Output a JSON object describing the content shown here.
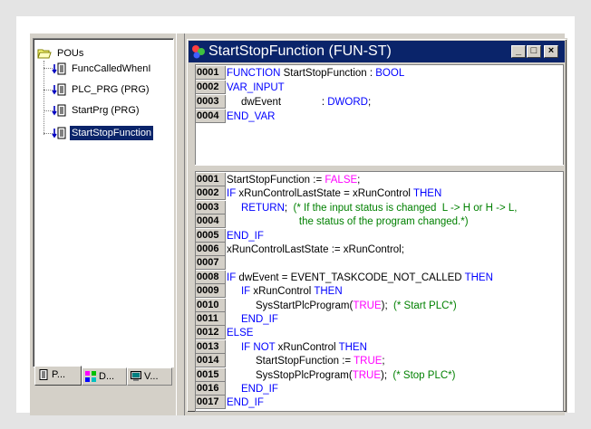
{
  "tree": {
    "root": "POUs",
    "items": [
      {
        "label": "FuncCalledWhenI",
        "selected": false
      },
      {
        "label": "PLC_PRG (PRG)",
        "selected": false
      },
      {
        "label": "StartPrg (PRG)",
        "selected": false
      },
      {
        "label": "StartStopFunction",
        "selected": true
      }
    ]
  },
  "tabs": [
    {
      "label": "P...",
      "icon": "pous-tab-icon"
    },
    {
      "label": "D...",
      "icon": "datatypes-tab-icon"
    },
    {
      "label": "V...",
      "icon": "visualizations-tab-icon"
    }
  ],
  "window": {
    "title": "StartStopFunction (FUN-ST)",
    "minimize": "_",
    "maximize": "□",
    "close": "×"
  },
  "declaration": [
    {
      "num": "0001",
      "parts": [
        {
          "t": "FUNCTION",
          "c": "kw"
        },
        {
          "t": " StartStopFunction : ",
          "c": ""
        },
        {
          "t": "BOOL",
          "c": "kw"
        }
      ]
    },
    {
      "num": "0002",
      "parts": [
        {
          "t": "VAR_INPUT",
          "c": "kw"
        }
      ]
    },
    {
      "num": "0003",
      "parts": [
        {
          "t": "     dwEvent              : ",
          "c": ""
        },
        {
          "t": "DWORD",
          "c": "kw"
        },
        {
          "t": ";",
          "c": ""
        }
      ]
    },
    {
      "num": "0004",
      "parts": [
        {
          "t": "END_VAR",
          "c": "kw"
        }
      ]
    }
  ],
  "body": [
    {
      "num": "0001",
      "parts": [
        {
          "t": "StartStopFunction := ",
          "c": ""
        },
        {
          "t": "FALSE",
          "c": "lit"
        },
        {
          "t": ";",
          "c": ""
        }
      ]
    },
    {
      "num": "0002",
      "parts": [
        {
          "t": "IF",
          "c": "kw"
        },
        {
          "t": " xRunControlLastState = xRunControl ",
          "c": ""
        },
        {
          "t": "THEN",
          "c": "kw"
        }
      ]
    },
    {
      "num": "0003",
      "parts": [
        {
          "t": "     ",
          "c": ""
        },
        {
          "t": "RETURN",
          "c": "kw"
        },
        {
          "t": ";  ",
          "c": ""
        },
        {
          "t": "(* If the input status is changed  L -> H or H -> L,",
          "c": "cm"
        }
      ]
    },
    {
      "num": "0004",
      "parts": [
        {
          "t": "                         the status of the program changed.*)",
          "c": "cm"
        }
      ]
    },
    {
      "num": "0005",
      "parts": [
        {
          "t": "END_IF",
          "c": "kw"
        }
      ]
    },
    {
      "num": "0006",
      "parts": [
        {
          "t": "xRunControlLastState := xRunControl;",
          "c": ""
        }
      ]
    },
    {
      "num": "0007",
      "parts": []
    },
    {
      "num": "0008",
      "parts": [
        {
          "t": "IF",
          "c": "kw"
        },
        {
          "t": " dwEvent = EVENT_TASKCODE_NOT_CALLED ",
          "c": ""
        },
        {
          "t": "THEN",
          "c": "kw"
        }
      ]
    },
    {
      "num": "0009",
      "parts": [
        {
          "t": "     ",
          "c": ""
        },
        {
          "t": "IF",
          "c": "kw"
        },
        {
          "t": " xRunControl ",
          "c": ""
        },
        {
          "t": "THEN",
          "c": "kw"
        }
      ]
    },
    {
      "num": "0010",
      "parts": [
        {
          "t": "          SysStartPlcProgram(",
          "c": ""
        },
        {
          "t": "TRUE",
          "c": "lit"
        },
        {
          "t": ");  ",
          "c": ""
        },
        {
          "t": "(* Start PLC*)",
          "c": "cm"
        }
      ]
    },
    {
      "num": "0011",
      "parts": [
        {
          "t": "     ",
          "c": ""
        },
        {
          "t": "END_IF",
          "c": "kw"
        }
      ]
    },
    {
      "num": "0012",
      "parts": [
        {
          "t": "ELSE",
          "c": "kw"
        }
      ]
    },
    {
      "num": "0013",
      "parts": [
        {
          "t": "     ",
          "c": ""
        },
        {
          "t": "IF NOT",
          "c": "kw"
        },
        {
          "t": " xRunControl ",
          "c": ""
        },
        {
          "t": "THEN",
          "c": "kw"
        }
      ]
    },
    {
      "num": "0014",
      "parts": [
        {
          "t": "          StartStopFunction := ",
          "c": ""
        },
        {
          "t": "TRUE",
          "c": "lit"
        },
        {
          "t": ";",
          "c": ""
        }
      ]
    },
    {
      "num": "0015",
      "parts": [
        {
          "t": "          SysStopPlcProgram(",
          "c": ""
        },
        {
          "t": "TRUE",
          "c": "lit"
        },
        {
          "t": ");  ",
          "c": ""
        },
        {
          "t": "(* Stop PLC*)",
          "c": "cm"
        }
      ]
    },
    {
      "num": "0016",
      "parts": [
        {
          "t": "     ",
          "c": ""
        },
        {
          "t": "END_IF",
          "c": "kw"
        }
      ]
    },
    {
      "num": "0017",
      "parts": [
        {
          "t": "END_IF",
          "c": "kw"
        }
      ]
    }
  ],
  "colors": {
    "keyword": "#0000ff",
    "comment": "#008000",
    "literal": "#ff00ff",
    "titlebar": "#0a246a",
    "selection": "#0a246a"
  }
}
